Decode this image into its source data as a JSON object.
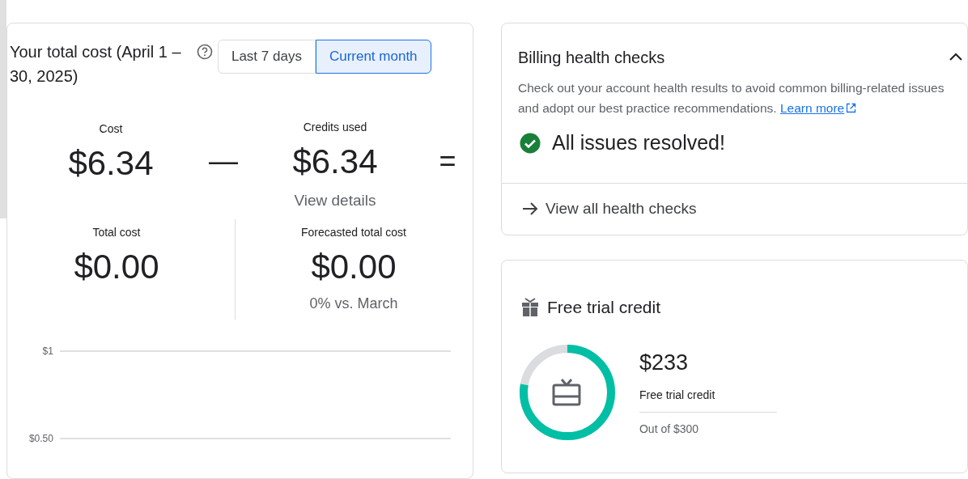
{
  "cost_card": {
    "title": "Your total cost (April 1 – 30, 2025)",
    "ranges": [
      {
        "label": "Last 7 days",
        "selected": false
      },
      {
        "label": "Current month",
        "selected": true
      }
    ],
    "cost": {
      "label": "Cost",
      "value": "$6.34"
    },
    "minus_sign": "—",
    "credits": {
      "label": "Credits used",
      "value": "$6.34",
      "link": "View details"
    },
    "equals_sign": "=",
    "total": {
      "label": "Total cost",
      "value": "$0.00"
    },
    "forecast": {
      "label": "Forecasted total cost",
      "value": "$0.00",
      "comparison": "0% vs. March"
    },
    "chart": {
      "y_labels": [
        "$1",
        "$0.50"
      ]
    }
  },
  "health_card": {
    "title": "Billing health checks",
    "expanded": true,
    "description": "Check out your account health results to avoid common billing-related issues and adopt our best practice recommendations.",
    "learn_more": "Learn more",
    "status": "All issues resolved!",
    "view_all": "View all health checks"
  },
  "credit_card": {
    "title": "Free trial credit",
    "credits": [
      {
        "amount": "$233",
        "label": "Free trial credit",
        "total": "Out of $300",
        "level": 0.777
      }
    ]
  }
}
